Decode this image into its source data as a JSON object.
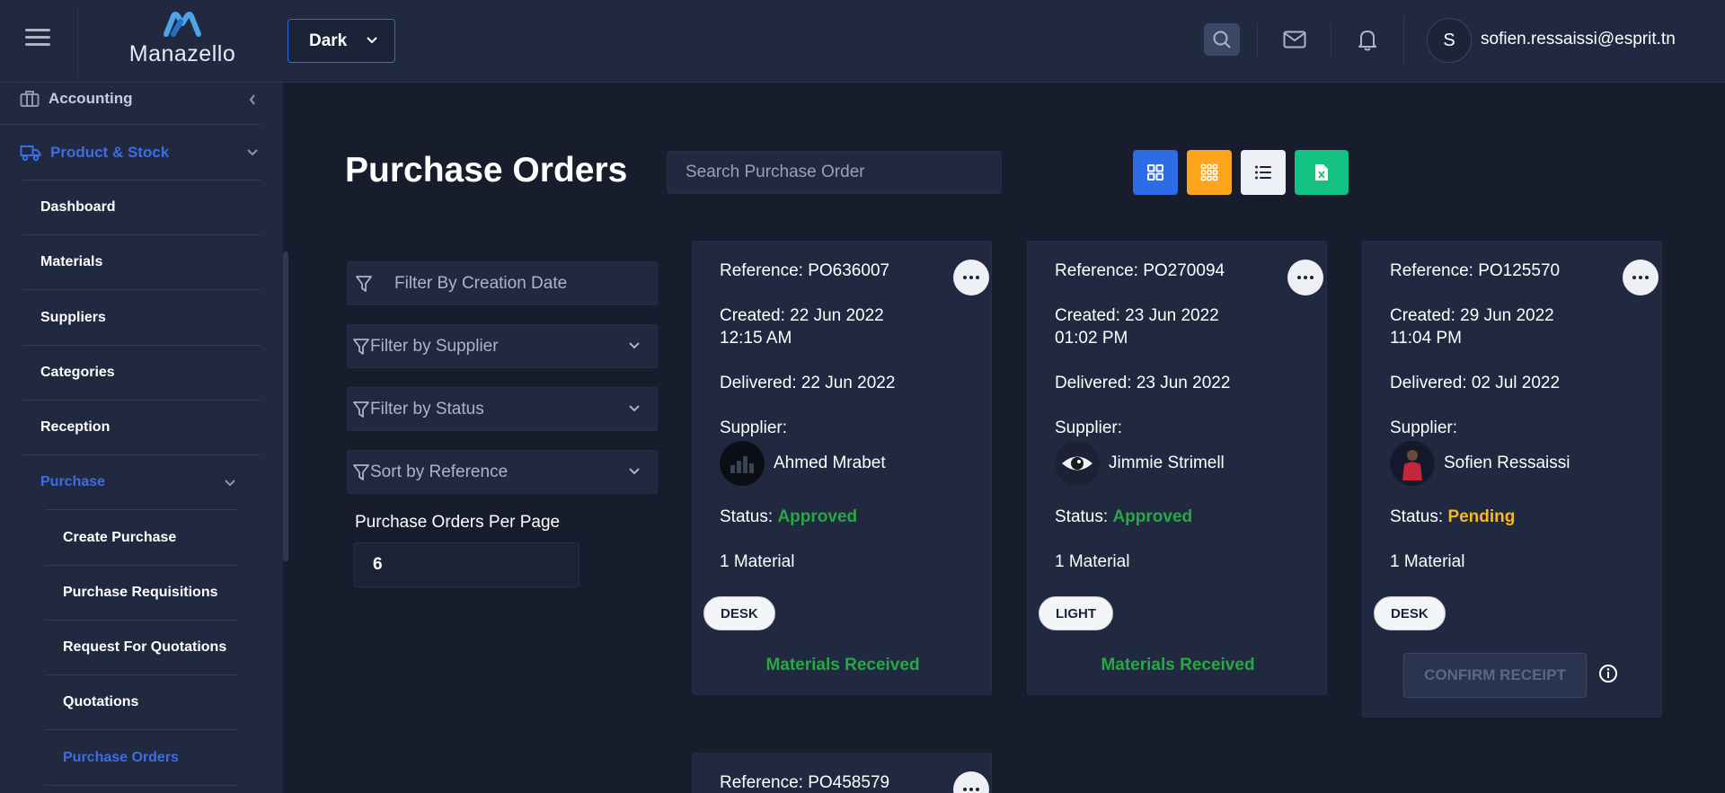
{
  "header": {
    "logo_text": "Manazello",
    "theme": "Dark",
    "user_initial": "S",
    "user_email": "sofien.ressaissi@esprit.tn"
  },
  "sidebar": {
    "accounting": "Accounting",
    "product_stock": "Product & Stock",
    "items": [
      "Dashboard",
      "Materials",
      "Suppliers",
      "Categories",
      "Reception"
    ],
    "purchase": "Purchase",
    "purchase_sub": [
      "Create Purchase",
      "Purchase Requisitions",
      "Request For Quotations",
      "Quotations",
      "Purchase Orders"
    ]
  },
  "main": {
    "title": "Purchase Orders",
    "search_placeholder": "Search Purchase Order",
    "filters": {
      "creation_date": "Filter By Creation Date",
      "supplier": "Filter by Supplier",
      "status": "Filter by Status",
      "sort": "Sort by Reference"
    },
    "per_page_label": "Purchase Orders Per Page",
    "per_page_value": "6"
  },
  "cards": [
    {
      "reference": "Reference: PO636007",
      "created_1": "Created: 22 Jun 2022",
      "created_2": "12:15 AM",
      "delivered": "Delivered: 22 Jun 2022",
      "supplier_label": "Supplier:",
      "supplier_name": "Ahmed Mrabet",
      "status_label": "Status:",
      "status": "Approved",
      "materials": "1 Material",
      "tag": "DESK",
      "action": "Materials Received"
    },
    {
      "reference": "Reference: PO270094",
      "created_1": "Created: 23 Jun 2022",
      "created_2": "01:02 PM",
      "delivered": "Delivered: 23 Jun 2022",
      "supplier_label": "Supplier:",
      "supplier_name": "Jimmie Strimell",
      "status_label": "Status:",
      "status": "Approved",
      "materials": "1 Material",
      "tag": "LIGHT",
      "action": "Materials Received"
    },
    {
      "reference": "Reference: PO125570",
      "created_1": "Created: 29 Jun 2022",
      "created_2": "11:04 PM",
      "delivered": "Delivered: 02 Jul 2022",
      "supplier_label": "Supplier:",
      "supplier_name": "Sofien Ressaissi",
      "status_label": "Status:",
      "status": "Pending",
      "materials": "1 Material",
      "tag": "DESK",
      "action": "CONFIRM RECEIPT"
    },
    {
      "reference": "Reference: PO458579"
    }
  ],
  "colors": {
    "accent_blue": "#2e6be6",
    "approved": "#27a745",
    "pending": "#f6b81a",
    "excel_green": "#13c183",
    "grid_orange": "#fba41c"
  }
}
